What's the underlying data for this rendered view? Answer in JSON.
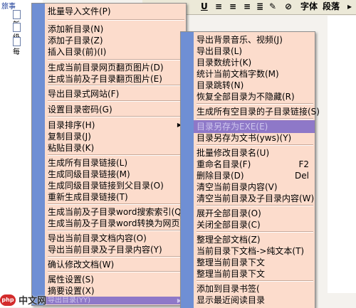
{
  "tree": {
    "root_label": "旅事",
    "nodes": [
      "新",
      "级",
      "每"
    ]
  },
  "toolbar": {
    "bold": "B",
    "italic": "I",
    "underline": "U",
    "font": "字体",
    "paragraph": "段落"
  },
  "menu1": [
    "批量导入文件(P)",
    "添加新目录(N)",
    "添加子目录(Z)",
    "插入目录(前)(I)",
    "生成当前目录网页翻页图片(D)",
    "生成当前及子目录翻页图片(E)",
    "导出目录式网站(F)",
    "设置目录密码(G)",
    "目录排序(H)",
    "复制目录(J)",
    "粘贴目录(K)",
    "生成所有目录链接(L)",
    "生成同级目录链接(M)",
    "生成同级目录链接到父目录(O)",
    "重新生成目录链接(T)",
    "生成当前及子目录word搜索索引(Q)",
    "生成当前及子目录word转换为网页(R)",
    "导出当前目录文档内容(O)",
    "导出当前目录及子目录内容(Y)",
    "确认修改文档(W)",
    "属性设置(S)",
    "摘要设置(X)",
    "导出目录(YY)"
  ],
  "menu2": [
    "导出背景音乐、视频(J)",
    "导出目录(L)",
    "目录数统计(K)",
    "统计当前文档字数(M)",
    "目录跳转(N)",
    "恢复全部目录为不隐藏(R)",
    "生成所有空目录的子目录链接(S)",
    "目录另存为EXE(E)",
    "目录另存为文书(yws)(Y)",
    "批量修改目录名(U)",
    "重命名目录(F)",
    "删除目录(D)",
    "清空当前目录内容(V)",
    "清空当前目录及子目录内容(W)",
    "展开全部目录(O)",
    "关闭全部目录(C)",
    "整理全部文档(Z)",
    "当前目录下文档->纯文本(T)",
    "整理当前目录下文",
    "整理当前目录下文",
    "添加到目录书签(",
    "显示最近阅读目录"
  ],
  "shortcuts": {
    "rename": "F2",
    "delete": "Del"
  },
  "watermark": {
    "logo": "php",
    "text": "中文网"
  }
}
